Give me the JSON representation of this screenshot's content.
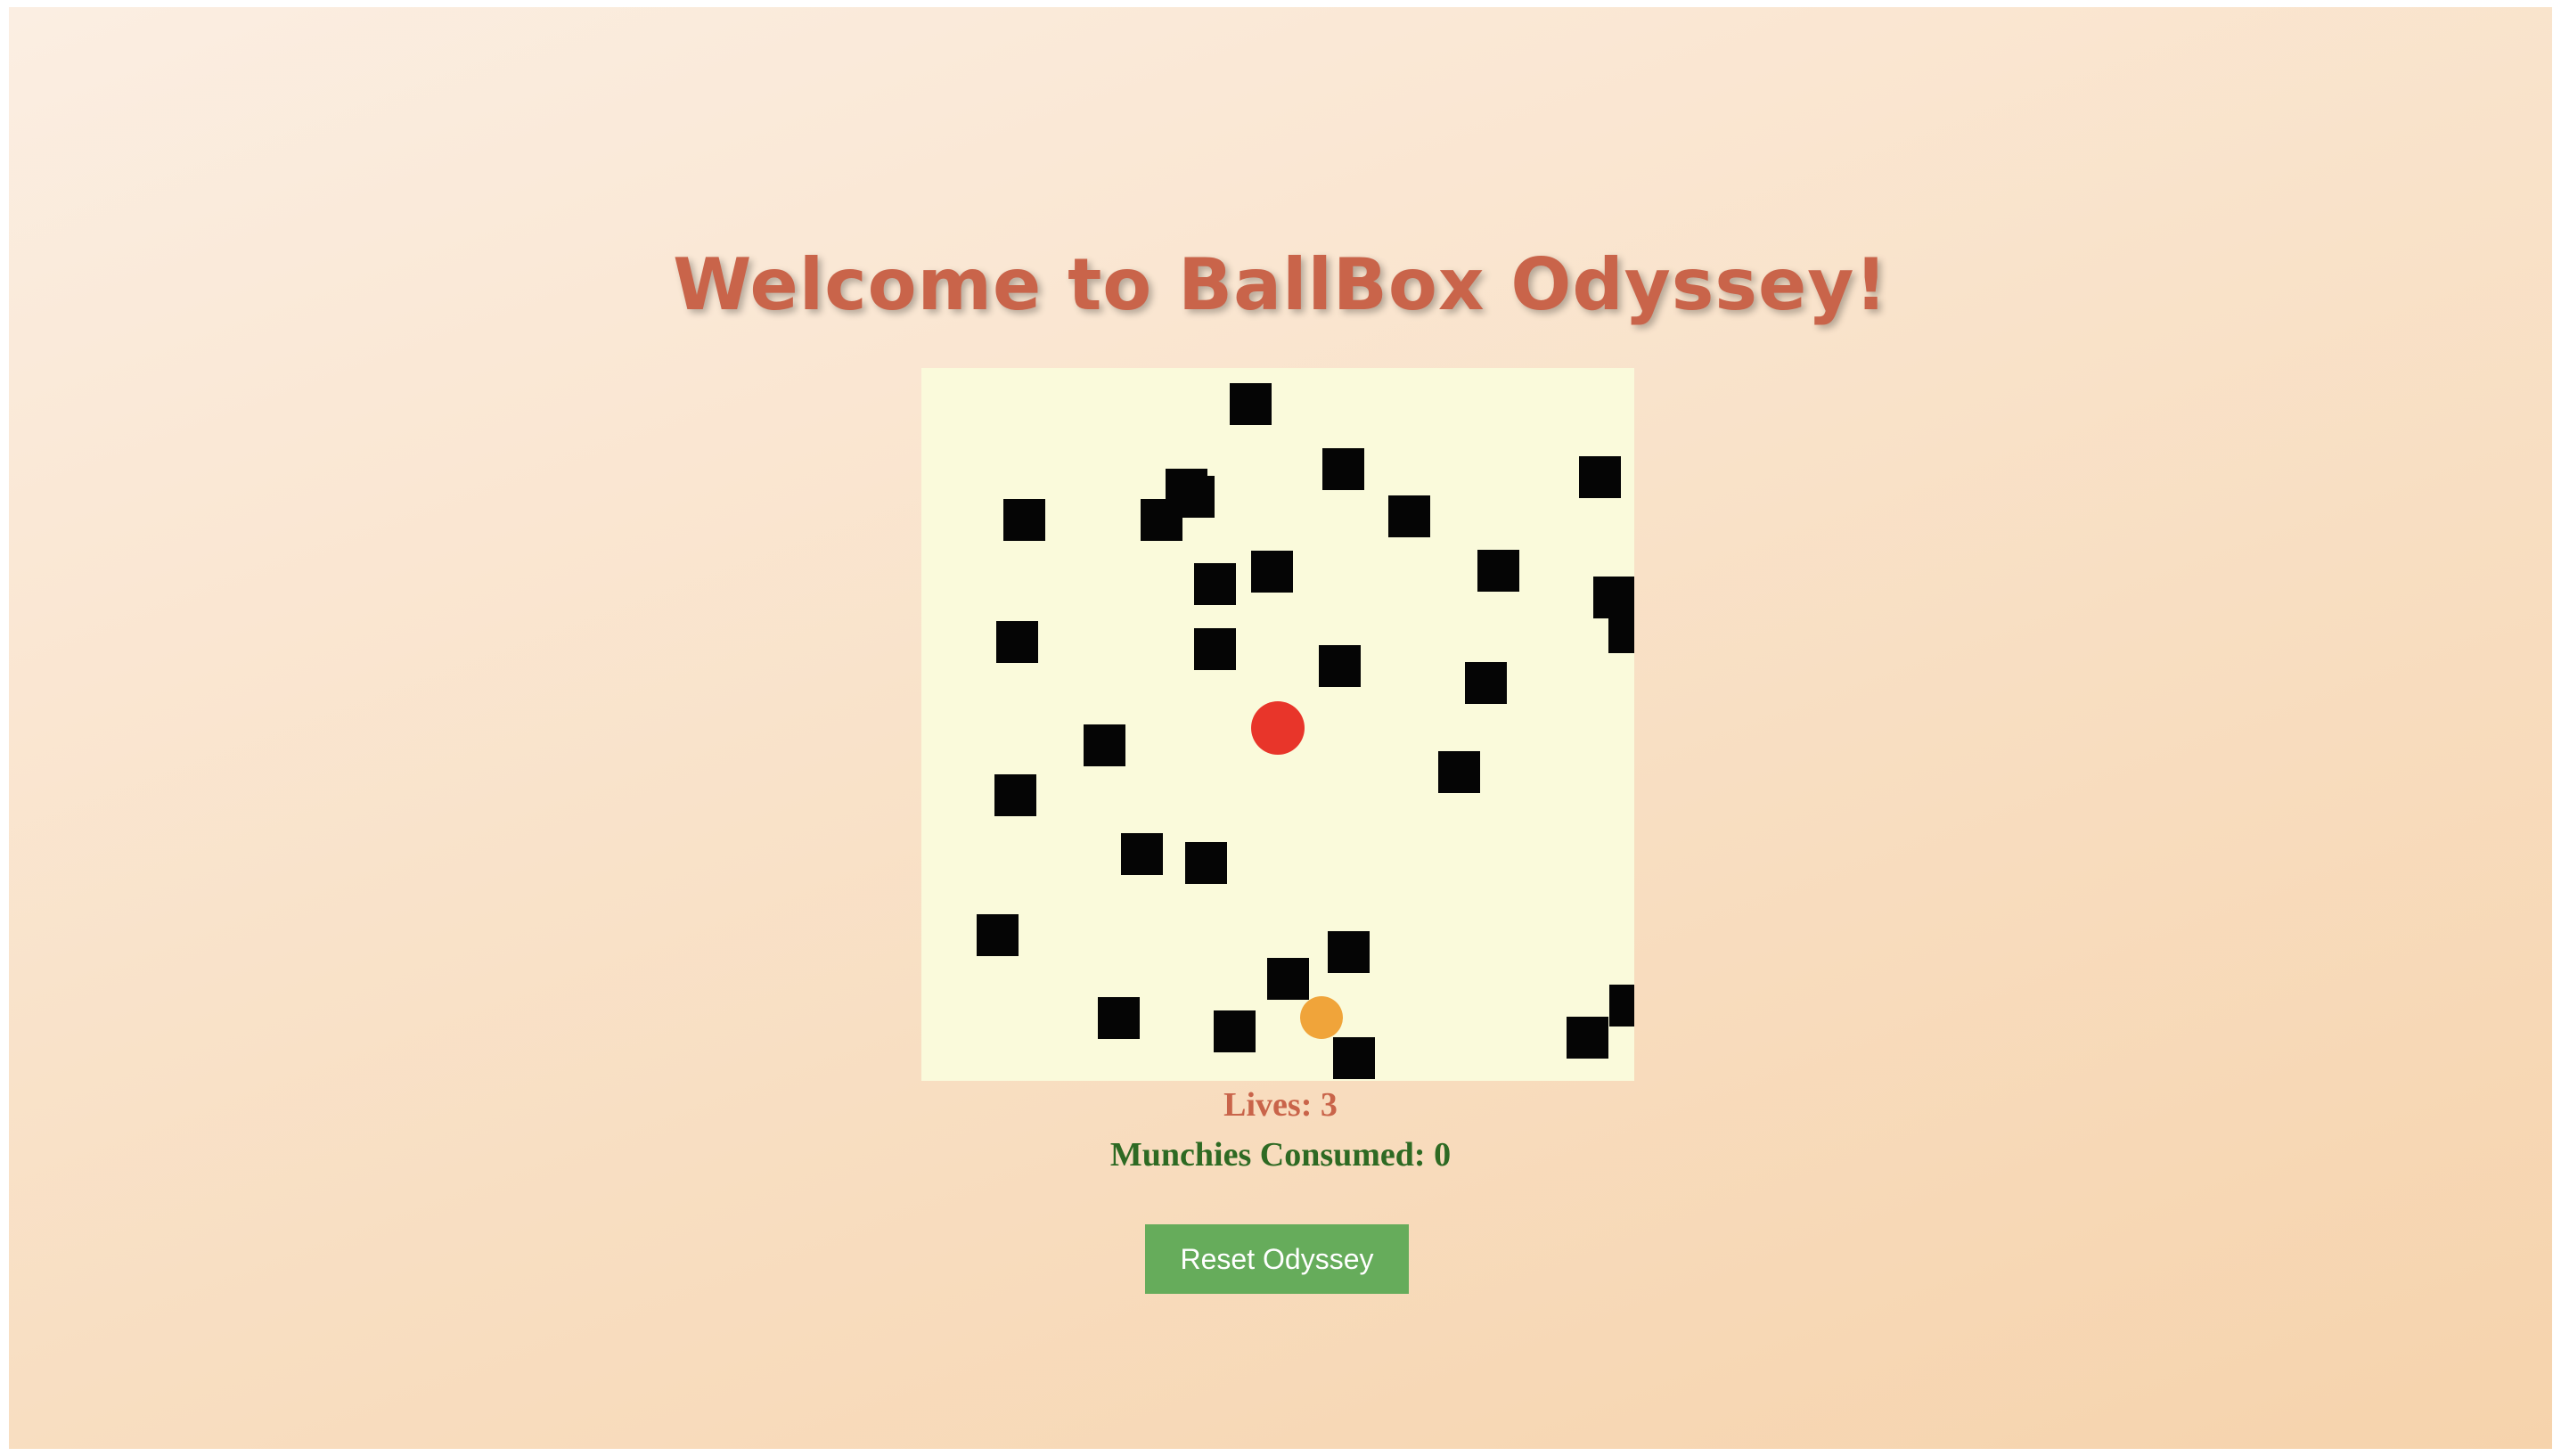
{
  "title": "Welcome to BallBox Odyssey!",
  "status": {
    "lives_text": "Lives: 3",
    "munchies_text": "Munchies Consumed: 0"
  },
  "reset_button_label": "Reset Odyssey",
  "colors": {
    "background_gradient": [
      "#fbeee2",
      "#f6d3ac"
    ],
    "title": "#c9644a",
    "board": "#fafadb",
    "obstacle": "#050505",
    "player_ball": "#e8352a",
    "munchie": "#f0a43a",
    "lives_text": "#c9644a",
    "munchies_text": "#2e6a23",
    "button": "#66ac5b"
  }
}
